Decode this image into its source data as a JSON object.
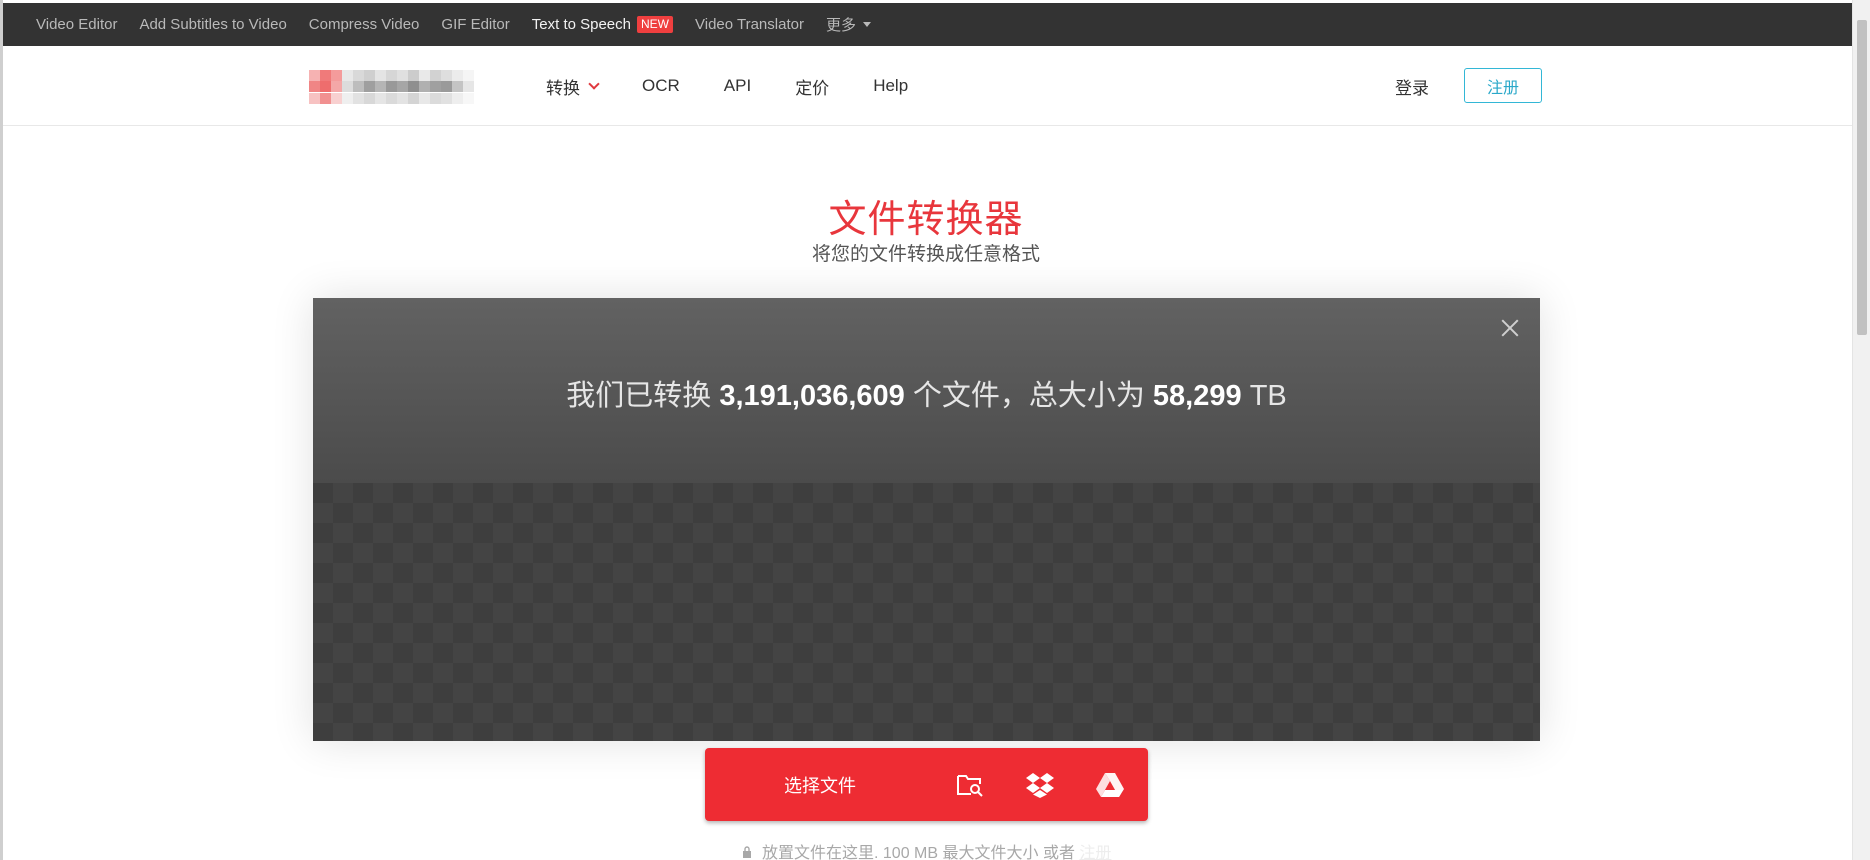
{
  "topbar": {
    "links": [
      "Video Editor",
      "Add Subtitles to Video",
      "Compress Video",
      "GIF Editor"
    ],
    "tts_label": "Text to Speech",
    "new_badge": "NEW",
    "translator_label": "Video Translator",
    "more_label": "更多"
  },
  "header": {
    "nav": {
      "convert": "转换",
      "ocr": "OCR",
      "api": "API",
      "pricing": "定价",
      "help": "Help"
    },
    "login_label": "登录",
    "signup_label": "注册"
  },
  "hero": {
    "title": "文件转换器",
    "subtitle": "将您的文件转换成任意格式"
  },
  "converter": {
    "stats_prefix": "我们已转换",
    "files_count": "3,191,036,609",
    "stats_middle": "个文件，总大小为",
    "total_size": "58,299",
    "size_unit": "TB",
    "choose_label": "选择文件",
    "sources": [
      "folder-search-icon",
      "dropbox-icon",
      "google-drive-icon"
    ],
    "hint_text": "放置文件在这里. 100 MB 最大文件大小 或者",
    "hint_link": "注册"
  },
  "colors": {
    "accent_red": "#ee2c33",
    "topbar_bg": "#333333",
    "signup_blue": "#33b7d6"
  }
}
